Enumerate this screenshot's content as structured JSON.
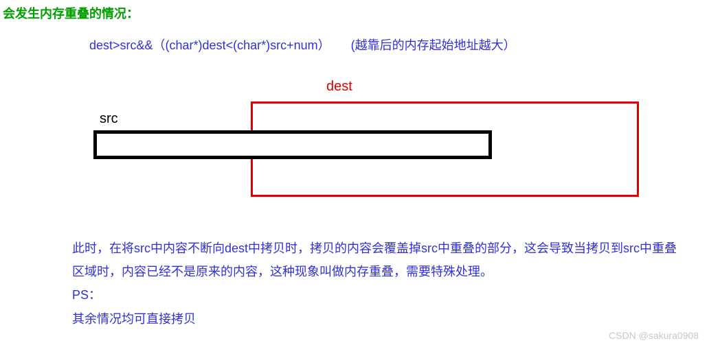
{
  "title": "会发生内存重叠的情况：",
  "condition": {
    "expr": "dest>src&&（(char*)dest<(char*)src+num）",
    "note": "(越靠后的内存起始地址越大）"
  },
  "diagram": {
    "destLabel": "dest",
    "srcLabel": "src"
  },
  "description": {
    "line1": "此时，在将src中内容不断向dest中拷贝时，拷贝的内容会覆盖掉src中重叠的部分，这会导致当拷贝到src中重叠区域时，内容已经不是原来的内容，这种现象叫做内存重叠，需要特殊处理。",
    "line2": "PS：",
    "line3": "其余情况均可直接拷贝"
  },
  "watermark": "CSDN @sakura0908"
}
